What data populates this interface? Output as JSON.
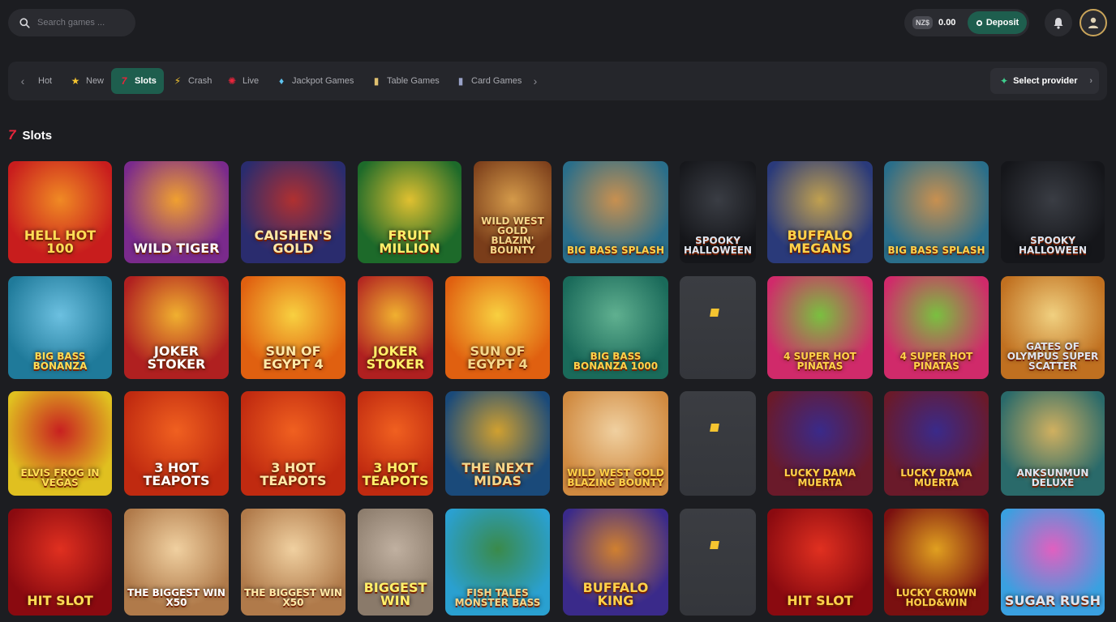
{
  "header": {
    "search_placeholder": "Search games ...",
    "currency": "NZ$",
    "balance": "0.00",
    "deposit_label": "Deposit"
  },
  "categories": [
    {
      "label": "Hot",
      "icon": "fire-icon"
    },
    {
      "label": "New",
      "icon": "star-icon"
    },
    {
      "label": "Slots",
      "icon": "seven-icon",
      "active": true
    },
    {
      "label": "Crash",
      "icon": "lightning-icon"
    },
    {
      "label": "Live",
      "icon": "roulette-icon"
    },
    {
      "label": "Jackpot Games",
      "icon": "diamond-icon"
    },
    {
      "label": "Table Games",
      "icon": "card-icon"
    },
    {
      "label": "Card Games",
      "icon": "cards-icon"
    }
  ],
  "provider_label": "Select provider",
  "section_title": "Slots",
  "games": [
    [
      "HELL HOT 100",
      "WILD TIGER",
      "Caishen's Gold",
      "FRUIT MILLION",
      "WILD WEST GOLD BLAZIN' BOUNTY",
      "BIG BASS SPLASH",
      "SPOOKY HALLOWEEN",
      "BUFFALO MEGANS",
      "BIG BASS SPLASH",
      "SPOOKY HALLOWEEN"
    ],
    [
      "BIG BASS BONANZA",
      "JOKER STOKER",
      "SUN OF EGYPT 4",
      "JOKER STOKER",
      "SUN OF EGYPT 4",
      "BIG BASS BONANZA 1000",
      "",
      "4 SUPER HOT PIÑATAS",
      "4 SUPER HOT PIÑATAS",
      "GATES OF OLYMPUS SUPER SCATTER"
    ],
    [
      "ELVIS FROG IN VEGAS",
      "3 HOT TEAPOTS",
      "3 HOT TEAPOTS",
      "3 HOT TEAPOTS",
      "THE NEXT MIDAS",
      "WILD WEST GOLD BLAZING BOUNTY",
      "",
      "Lucky Dama Muerta",
      "Lucky Dama Muerta",
      "ANKSUNMUN DELUXE"
    ],
    [
      "HIT SLOT",
      "THE BIGGEST WIN X50",
      "THE BIGGEST WIN X50",
      "BIGGEST WIN",
      "FISH TALES MONSTER BASS",
      "BUFFALO KING",
      "",
      "HIT SLOT",
      "Lucky Crown HOLD&WIN",
      "Sugar Rush"
    ]
  ],
  "colors": {
    "accent": "#1e5e4e",
    "background": "#1c1d21",
    "panel": "#25262b"
  }
}
